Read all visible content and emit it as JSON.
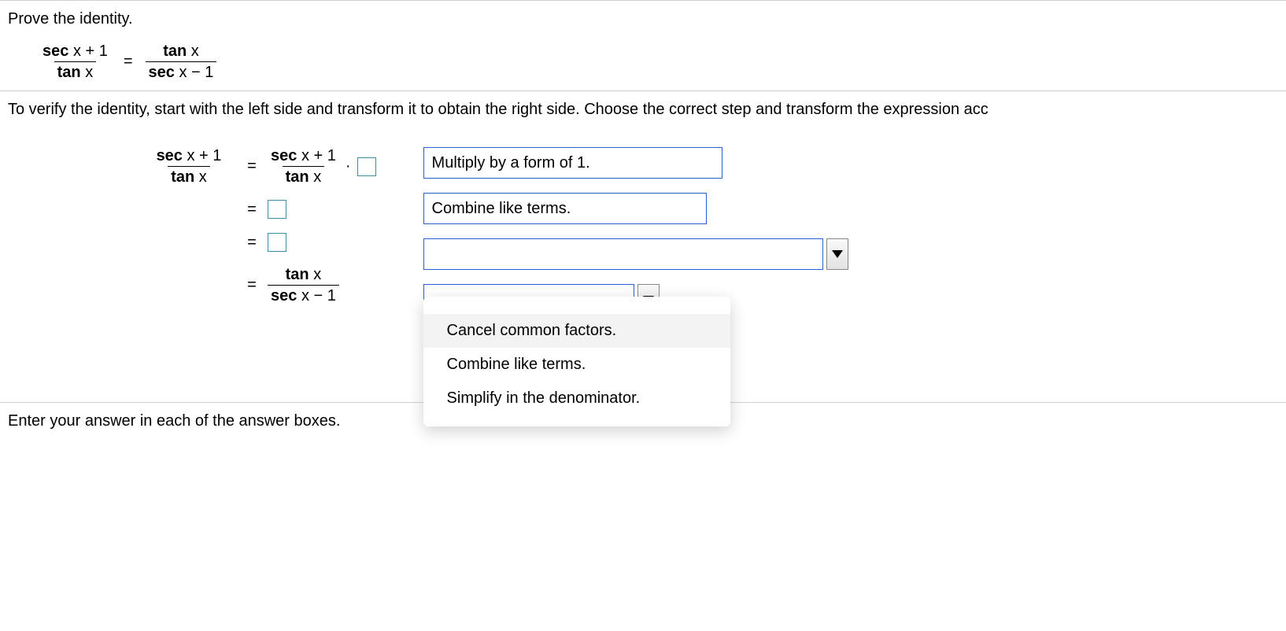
{
  "sections": {
    "prove_prompt": "Prove the identity.",
    "identity": {
      "lhs_num": "sec x + 1",
      "lhs_den": "tan x",
      "rhs_num": "tan x",
      "rhs_den": "sec x − 1",
      "equals": "="
    },
    "verify_text": "To verify the identity, start with the left side and transform it to obtain the right side. Choose the correct step and transform the expression acc"
  },
  "steps": {
    "row1": {
      "lhs_num": "sec x + 1",
      "lhs_den": "tan x",
      "rhs_num": "sec x + 1",
      "rhs_den": "tan x",
      "eq": "=",
      "dot": "·"
    },
    "row2": {
      "eq": "="
    },
    "row3": {
      "eq": "="
    },
    "row4": {
      "eq": "=",
      "rhs_num": "tan x",
      "rhs_den": "sec x − 1"
    }
  },
  "controls": {
    "field1": "Multiply by a form of 1.",
    "field2": "Combine like terms.",
    "combo3_value": "",
    "combo4_value": ""
  },
  "dropdown": {
    "opt1": "Cancel common factors.",
    "opt2": "Combine like terms.",
    "opt3": "Simplify in the denominator."
  },
  "footer": "Enter your answer in each of the answer boxes."
}
